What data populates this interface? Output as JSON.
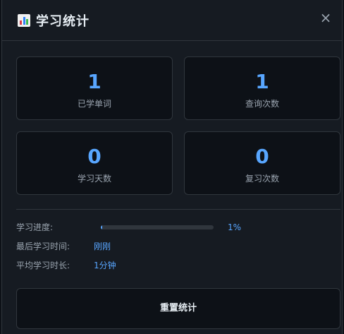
{
  "header": {
    "title": "学习统计",
    "icon": "bar-chart-icon",
    "close_label": "×"
  },
  "stats": [
    {
      "value": "1",
      "label": "已学单词"
    },
    {
      "value": "1",
      "label": "查询次数"
    },
    {
      "value": "0",
      "label": "学习天数"
    },
    {
      "value": "0",
      "label": "复习次数"
    }
  ],
  "details": {
    "progress_label": "学习进度:",
    "progress_value": "1%",
    "progress_fraction": 0.01,
    "last_label": "最后学习时间:",
    "last_value": "刚刚",
    "avg_label": "平均学习时长:",
    "avg_value": "1分钟"
  },
  "reset_label": "重置统计",
  "colors": {
    "accent": "#58a6ff",
    "background": "#161b22",
    "card": "#0d1117",
    "border": "#30363d"
  }
}
